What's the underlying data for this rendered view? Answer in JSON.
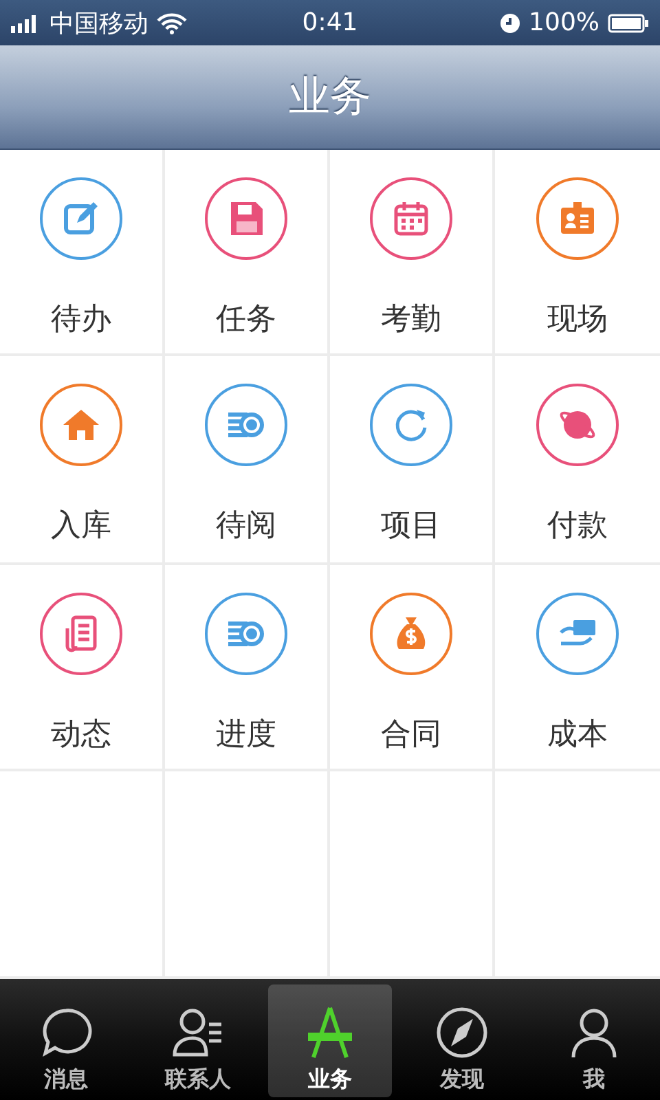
{
  "status_bar": {
    "carrier": "中国移动",
    "time": "0:41",
    "battery": "100%"
  },
  "header": {
    "title": "业务"
  },
  "modules": [
    {
      "label": "待办",
      "color": "#4a9fe0"
    },
    {
      "label": "任务",
      "color": "#e8507a"
    },
    {
      "label": "考勤",
      "color": "#e8507a"
    },
    {
      "label": "现场",
      "color": "#f07a2a"
    },
    {
      "label": "入库",
      "color": "#f07a2a"
    },
    {
      "label": "待阅",
      "color": "#4a9fe0"
    },
    {
      "label": "项目",
      "color": "#4a9fe0"
    },
    {
      "label": "付款",
      "color": "#e8507a"
    },
    {
      "label": "动态",
      "color": "#e8507a"
    },
    {
      "label": "进度",
      "color": "#4a9fe0"
    },
    {
      "label": "合同",
      "color": "#f07a2a"
    },
    {
      "label": "成本",
      "color": "#4a9fe0"
    }
  ],
  "tab_bar": [
    {
      "label": "消息",
      "selected": false
    },
    {
      "label": "联系人",
      "selected": false
    },
    {
      "label": "业务",
      "selected": true
    },
    {
      "label": "发现",
      "selected": false
    },
    {
      "label": "我",
      "selected": false
    }
  ]
}
